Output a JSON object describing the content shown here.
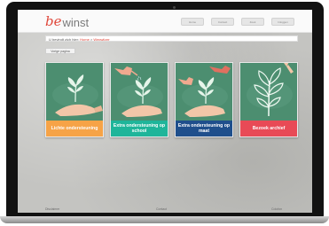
{
  "logo": {
    "mark": "be",
    "text": "winst"
  },
  "nav": {
    "items": [
      "Home",
      "Contact",
      "Zoek",
      "Inloggen"
    ]
  },
  "breadcrumb": {
    "prefix": "U bevindt zich hier: ",
    "home": "Home",
    "separator": " > ",
    "current": "Wegwijzer"
  },
  "back_button": {
    "label": "Vorige pagina"
  },
  "tiles": [
    {
      "label": "Lichte ondersteuning",
      "color": "#f6a347"
    },
    {
      "label": "Extra ondersteuning op school",
      "color": "#1fb59a"
    },
    {
      "label": "Extra ondersteuning op maat",
      "color": "#1f4f8c"
    },
    {
      "label": "Bezoek archief",
      "color": "#e84a56"
    }
  ],
  "footer": {
    "left": "Disclaimer",
    "center": "Contact",
    "right": "Colofon"
  }
}
